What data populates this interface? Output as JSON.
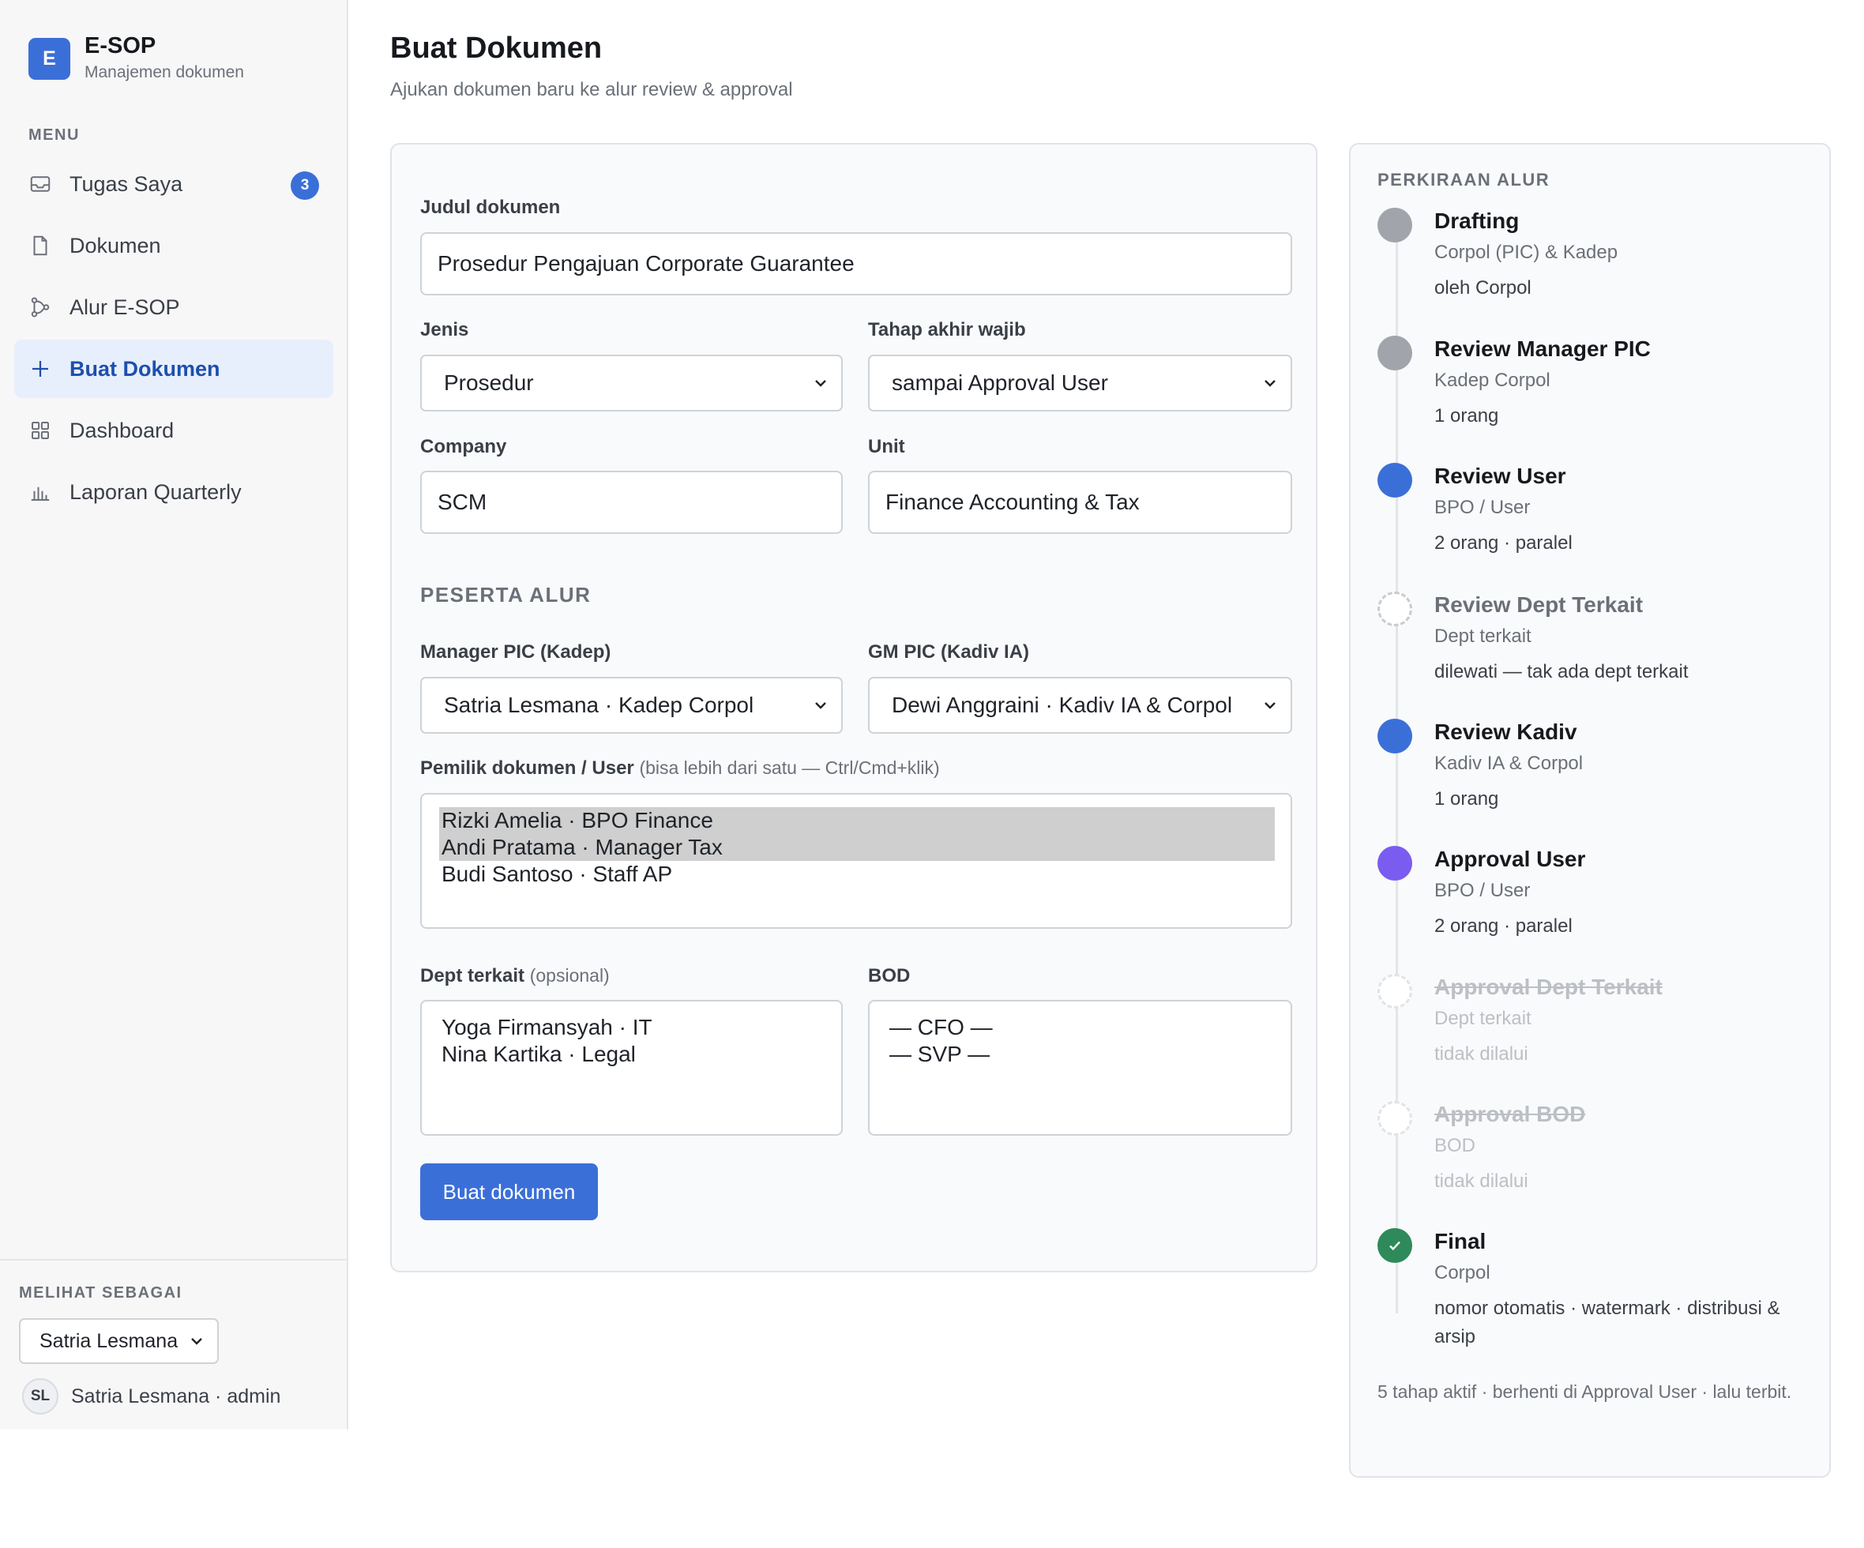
{
  "brand": {
    "logo_letter": "E",
    "title": "E-SOP",
    "subtitle": "Manajemen dokumen"
  },
  "sidebar": {
    "menu_label": "MENU",
    "items": [
      {
        "label": "Tugas Saya",
        "icon": "inbox-icon",
        "badge": "3",
        "active": false
      },
      {
        "label": "Dokumen",
        "icon": "file-icon",
        "active": false
      },
      {
        "label": "Alur E-SOP",
        "icon": "workflow-icon",
        "active": false
      },
      {
        "label": "Buat Dokumen",
        "icon": "plus-icon",
        "active": true
      },
      {
        "label": "Dashboard",
        "icon": "grid-icon",
        "active": false
      },
      {
        "label": "Laporan Quarterly",
        "icon": "bar-chart-icon",
        "active": false
      }
    ],
    "footer": {
      "label": "MELIHAT SEBAGAI",
      "view_as_value": "Satria Lesmana",
      "avatar_initials": "SL",
      "user_text": "Satria Lesmana · admin"
    }
  },
  "page": {
    "title": "Buat Dokumen",
    "subtitle": "Ajukan dokumen baru ke alur review & approval"
  },
  "form": {
    "judul_label": "Judul dokumen",
    "judul_value": "Prosedur Pengajuan Corporate Guarantee",
    "jenis_label": "Jenis",
    "jenis_value": "Prosedur",
    "tahap_label": "Tahap akhir wajib",
    "tahap_value": "sampai Approval User",
    "company_label": "Company",
    "company_value": "SCM",
    "unit_label": "Unit",
    "unit_value": "Finance Accounting & Tax",
    "section_title": "PESERTA ALUR",
    "manager_label": "Manager PIC (Kadep)",
    "manager_value": "Satria Lesmana · Kadep Corpol",
    "gm_label": "GM PIC (Kadiv IA)",
    "gm_value": "Dewi Anggraini · Kadiv IA & Corpol",
    "owner_label": "Pemilik dokumen / User",
    "owner_hint": "(bisa lebih dari satu — Ctrl/Cmd+klik)",
    "owner_options": [
      {
        "label": "Rizki Amelia · BPO Finance",
        "selected": true
      },
      {
        "label": "Andi Pratama · Manager Tax",
        "selected": true
      },
      {
        "label": "Budi Santoso · Staff AP",
        "selected": false
      }
    ],
    "dept_label": "Dept terkait",
    "dept_hint": "(opsional)",
    "dept_options": [
      "Yoga Firmansyah · IT",
      "Nina Kartika · Legal"
    ],
    "bod_label": "BOD",
    "bod_options": [
      "— CFO —",
      "— SVP —"
    ],
    "submit_label": "Buat dokumen"
  },
  "flow": {
    "title": "PERKIRAAN ALUR",
    "steps": [
      {
        "title": "Drafting",
        "role": "Corpol (PIC) & Kadep",
        "note": "oleh Corpol",
        "status": "done"
      },
      {
        "title": "Review Manager PIC",
        "role": "Kadep Corpol",
        "note": "1 orang",
        "status": "done"
      },
      {
        "title": "Review User",
        "role": "BPO / User",
        "note": "2 orang · paralel",
        "status": "active"
      },
      {
        "title": "Review Dept Terkait",
        "role": "Dept terkait",
        "note": "dilewati — tak ada dept terkait",
        "status": "bypassed"
      },
      {
        "title": "Review Kadiv",
        "role": "Kadiv IA & Corpol",
        "note": "1 orang",
        "status": "active"
      },
      {
        "title": "Approval User",
        "role": "BPO / User",
        "note": "2 orang · paralel",
        "status": "approval"
      },
      {
        "title": "Approval Dept Terkait",
        "role": "Dept terkait",
        "note": "tidak dilalui",
        "status": "skipped"
      },
      {
        "title": "Approval BOD",
        "role": "BOD",
        "note": "tidak dilalui",
        "status": "skipped"
      },
      {
        "title": "Final",
        "role": "Corpol",
        "note": "nomor otomatis · watermark · distribusi & arsip",
        "status": "final"
      }
    ],
    "summary": "5 tahap aktif · berhenti di Approval User · lalu terbit."
  },
  "colors": {
    "accent": "#3b6fd8",
    "approval": "#7b5cf0",
    "final": "#2e8a5a",
    "done": "#a1a4ab"
  }
}
